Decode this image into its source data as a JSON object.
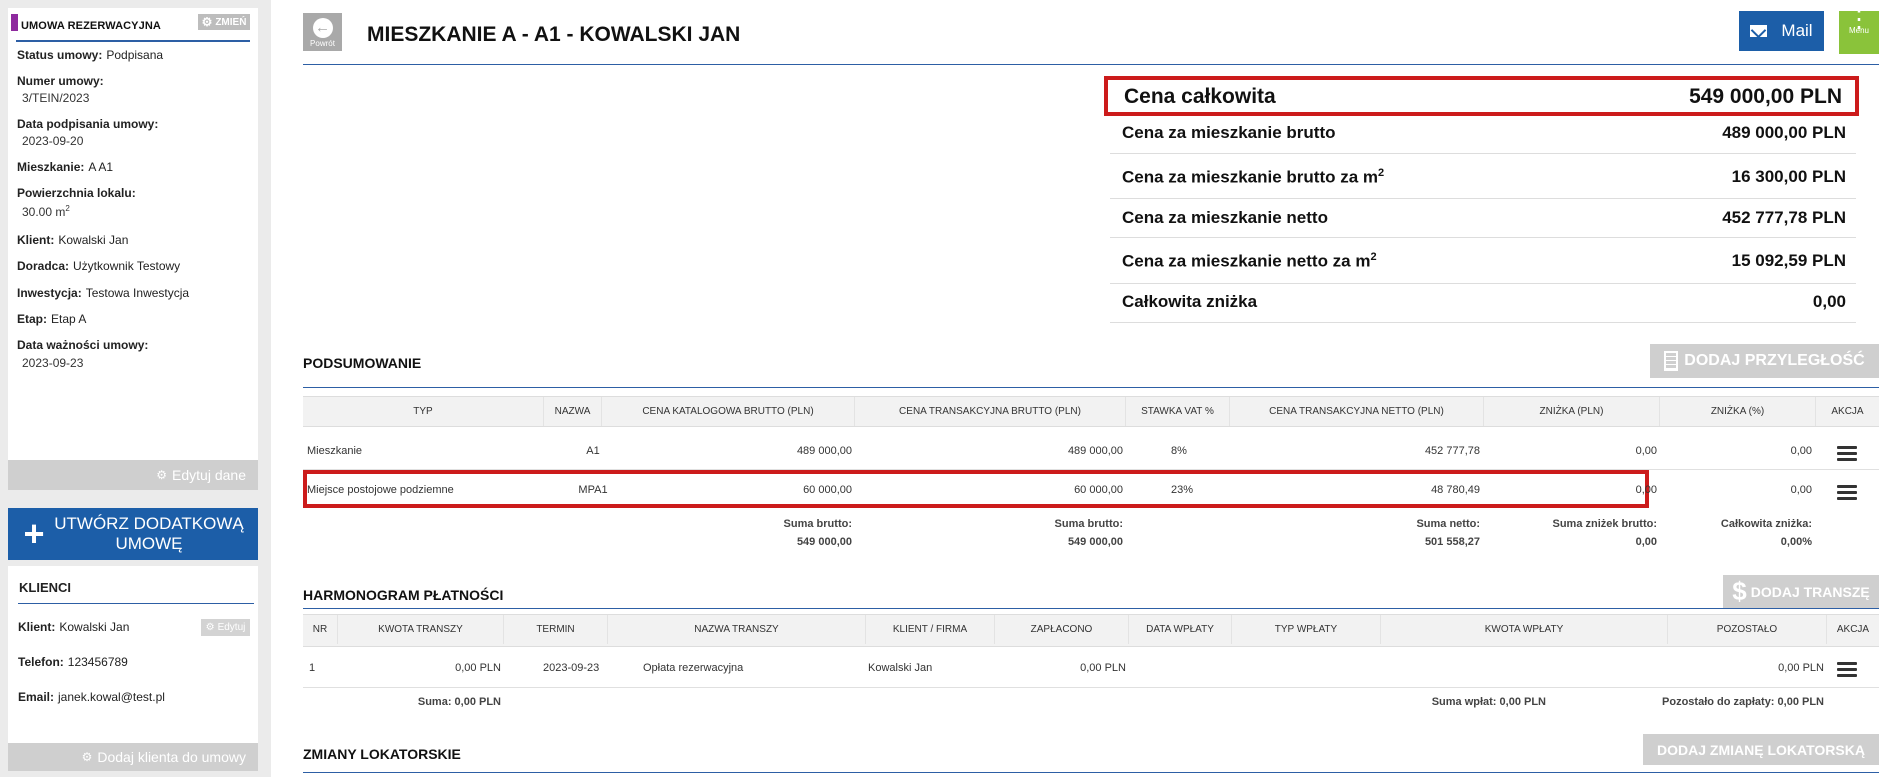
{
  "contract": {
    "header": "UMOWA REZERWACYJNA",
    "change_label": "ZMIEŃ",
    "status_label": "Status umowy:",
    "status_value": "Podpisana",
    "number_label": "Numer umowy:",
    "number_value": "3/TEIN/2023",
    "signed_label": "Data podpisania umowy:",
    "signed_value": "2023-09-20",
    "flat_label": "Mieszkanie:",
    "flat_value": "A A1",
    "area_label": "Powierzchnia lokalu:",
    "area_value": "30.00 m",
    "area_unit_sup": "2",
    "client_label": "Klient:",
    "client_value": "Kowalski Jan",
    "advisor_label": "Doradca:",
    "advisor_value": "Użytkownik Testowy",
    "investment_label": "Inwestycja:",
    "investment_value": "Testowa Inwestycja",
    "stage_label": "Etap:",
    "stage_value": "Etap A",
    "validity_label": "Data ważności umowy:",
    "validity_value": "2023-09-23",
    "edit_label": "Edytuj dane"
  },
  "create_additional_label": "UTWÓRZ DODATKOWĄ UMOWĘ",
  "clients": {
    "header": "KLIENCI",
    "client_label": "Klient:",
    "client_value": "Kowalski Jan",
    "edit_label": "Edytuj",
    "phone_label": "Telefon:",
    "phone_value": "123456789",
    "email_label": "Email:",
    "email_value": "janek.kowal@test.pl",
    "add_client_label": "Dodaj klienta do umowy"
  },
  "header": {
    "back_label": "Powrót",
    "title": "MIESZKANIE A - A1 - KOWALSKI JAN",
    "mail_label": "Mail",
    "menu_label": "Menu"
  },
  "prices": {
    "total_label": "Cena całkowita",
    "total_value": "549 000,00 PLN",
    "gross_label": "Cena za mieszkanie brutto",
    "gross_value": "489 000,00 PLN",
    "gross_m2_label": "Cena za mieszkanie brutto za m",
    "gross_m2_value": "16 300,00 PLN",
    "net_label": "Cena za mieszkanie netto",
    "net_value": "452 777,78 PLN",
    "net_m2_label": "Cena za mieszkanie netto za m",
    "net_m2_value": "15 092,59 PLN",
    "discount_label": "Całkowita zniżka",
    "discount_value": "0,00",
    "sup": "2"
  },
  "summary": {
    "title": "PODSUMOWANIE",
    "add_adjacent_label": "DODAJ PRZYLEGŁOŚĆ",
    "columns": [
      "TYP",
      "NAZWA",
      "CENA KATALOGOWA BRUTTO (PLN)",
      "CENA TRANSAKCYJNA BRUTTO (PLN)",
      "STAWKA VAT %",
      "CENA TRANSAKCYJNA NETTO (PLN)",
      "ZNIŻKA (PLN)",
      "ZNIŻKA (%)",
      "AKCJA"
    ],
    "rows": [
      {
        "type": "Mieszkanie",
        "name": "A1",
        "catalog_gross": "489 000,00",
        "trans_gross": "489 000,00",
        "vat": "8%",
        "trans_net": "452 777,78",
        "discount_pln": "0,00",
        "discount_pct": "0,00"
      },
      {
        "type": "Miejsce postojowe podziemne",
        "name": "MPA1",
        "catalog_gross": "60 000,00",
        "trans_gross": "60 000,00",
        "vat": "23%",
        "trans_net": "48 780,49",
        "discount_pln": "0,00",
        "discount_pct": "0,00"
      }
    ],
    "sum_gross_label": "Suma brutto:",
    "sum_catalog_gross": "549 000,00",
    "sum_trans_gross": "549 000,00",
    "sum_net_label": "Suma netto:",
    "sum_net": "501 558,27",
    "sum_disc_label": "Suma zniżek brutto:",
    "sum_disc": "0,00",
    "total_disc_label": "Całkowita zniżka:",
    "total_disc": "0,00%"
  },
  "schedule": {
    "title": "HARMONOGRAM PŁATNOŚCI",
    "add_tranche_label": "DODAJ TRANSZĘ",
    "columns": [
      "NR",
      "KWOTA TRANSZY",
      "TERMIN",
      "NAZWA TRANSZY",
      "KLIENT / FIRMA",
      "ZAPŁACONO",
      "DATA WPŁATY",
      "TYP WPŁATY",
      "KWOTA WPŁATY",
      "POZOSTAŁO",
      "AKCJA"
    ],
    "rows": [
      {
        "nr": "1",
        "amount": "0,00 PLN",
        "due": "2023-09-23",
        "name": "Opłata rezerwacyjna",
        "client": "Kowalski Jan",
        "paid": "0,00 PLN",
        "pay_date": "",
        "pay_type": "",
        "pay_amount": "",
        "remaining": "0,00 PLN"
      }
    ],
    "sum_label": "Suma: 0,00 PLN",
    "sum_paid_label": "Suma wpłat: 0,00 PLN",
    "remaining_label": "Pozostało do zapłaty: 0,00 PLN"
  },
  "tenant_changes": {
    "title": "ZMIANY LOKATORSKIE",
    "add_label": "DODAJ ZMIANĘ LOKATORSKĄ"
  }
}
